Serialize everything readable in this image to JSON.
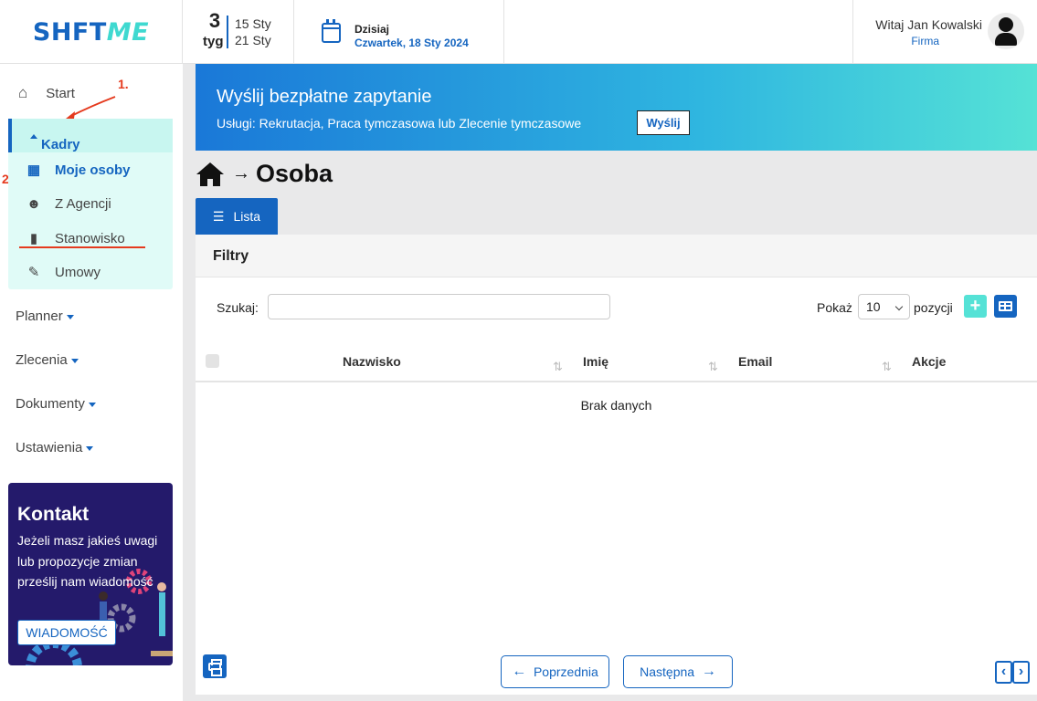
{
  "header": {
    "logo_part1": "SHFT",
    "logo_part2": "ME",
    "week_number": "3",
    "week_label": "tyg",
    "week_start": "15 Sty",
    "week_end": "21 Sty",
    "today_label": "Dzisiaj",
    "today_value": "Czwartek, 18 Sty 2024",
    "user_greeting": "Witaj Jan Kowalski",
    "user_company": "Firma"
  },
  "sidebar": {
    "start": "Start",
    "kadry": "Kadry",
    "kadry_items": [
      "Moje osoby",
      "Z Agencji",
      "Stanowisko",
      "Umowy"
    ],
    "groups": [
      "Planner",
      "Zlecenia",
      "Dokumenty",
      "Ustawienia"
    ],
    "annotation_1": "1.",
    "annotation_2": "2.",
    "contact": {
      "title": "Kontakt",
      "text": "Jeżeli masz jakieś uwagi lub propozycje zmian prześlij nam wiadomość",
      "button": "WIADOMOŚĆ"
    }
  },
  "banner": {
    "title": "Wyślij bezpłatne zapytanie",
    "subtitle": "Usługi: Rekrutacja, Praca tymczasowa lub Zlecenie tymczasowe",
    "button": "Wyślij"
  },
  "main": {
    "page_title": "Osoba",
    "tab": "Lista",
    "filters": "Filtry",
    "search_label": "Szukaj:",
    "search_value": "",
    "show_label": "Pokaż",
    "show_value": "10",
    "show_suffix": "pozycji",
    "columns": [
      "Nazwisko",
      "Imię",
      "Email",
      "Akcje"
    ],
    "empty": "Brak danych",
    "prev": "Poprzednia",
    "next": "Następna"
  },
  "colors": {
    "accent": "#1565c0",
    "highlight": "#e0fbf7",
    "annotation": "#e53a1e",
    "contact_bg": "#241a6b"
  }
}
